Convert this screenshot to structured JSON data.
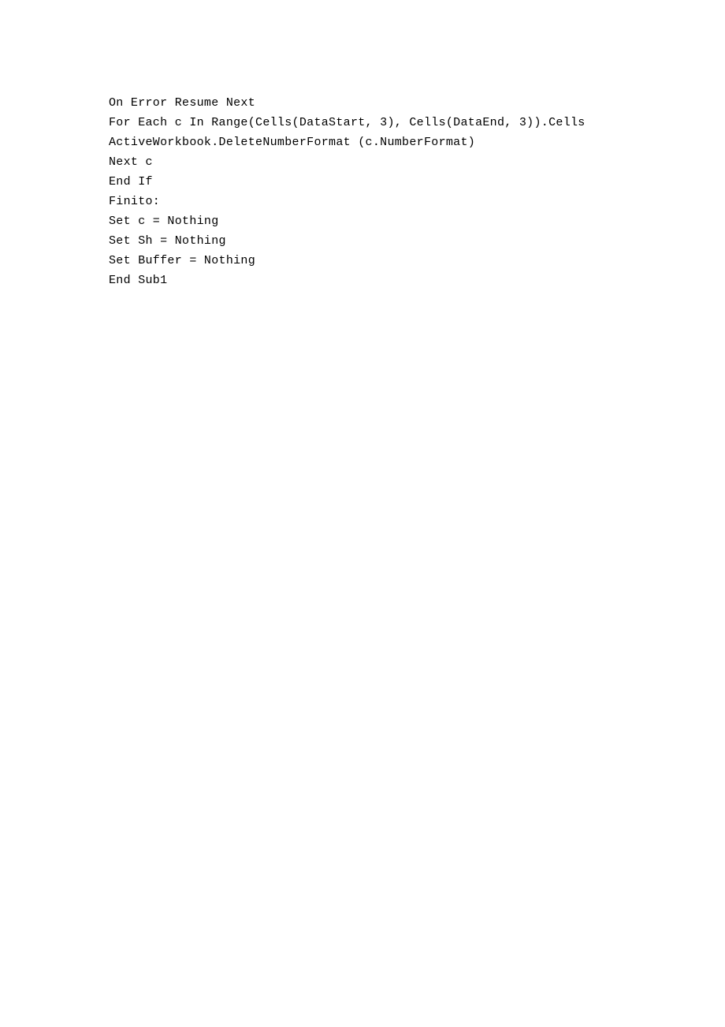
{
  "code": {
    "lines": [
      "On Error Resume Next",
      "For Each c In Range(Cells(DataStart, 3), Cells(DataEnd, 3)).Cells",
      "ActiveWorkbook.DeleteNumberFormat (c.NumberFormat)",
      "Next c",
      "End If",
      "Finito:",
      "Set c = Nothing",
      "Set Sh = Nothing",
      "Set Buffer = Nothing",
      "End Sub1"
    ]
  }
}
